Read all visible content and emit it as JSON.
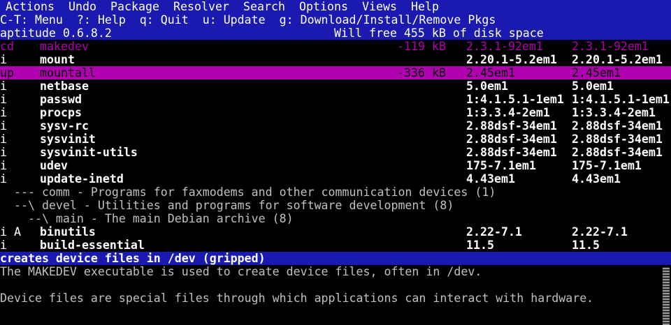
{
  "menubar": {
    "items": [
      "Actions",
      "Undo",
      "Package",
      "Resolver",
      "Search",
      "Options",
      "Views",
      "Help"
    ]
  },
  "hints": "C-T: Menu  ?: Help  q: Quit  u: Update  g: Download/Install/Remove Pkgs",
  "header": {
    "app": "aptitude 0.6.8.2",
    "status": "Will free 455 kB of disk space"
  },
  "packages": [
    {
      "flags": "cd",
      "name": "makedev",
      "size": "-119 kB",
      "v1": "2.3.1-92em1",
      "v2": "2.3.1-92em1",
      "style": "magenta"
    },
    {
      "flags": "i",
      "name": "mount",
      "size": "",
      "v1": "2.20.1-5.2em1",
      "v2": "2.20.1-5.2em1",
      "style": "normal"
    },
    {
      "flags": "up",
      "name": "mountall",
      "size": "-336 kB",
      "v1": "2.45em1",
      "v2": "2.45em1",
      "style": "selected"
    },
    {
      "flags": "i",
      "name": "netbase",
      "size": "",
      "v1": "5.0em1",
      "v2": "5.0em1",
      "style": "normal"
    },
    {
      "flags": "i",
      "name": "passwd",
      "size": "",
      "v1": "1:4.1.5.1-1em1",
      "v2": "1:4.1.5.1-1em1",
      "style": "normal"
    },
    {
      "flags": "i",
      "name": "procps",
      "size": "",
      "v1": "1:3.3.4-2em1",
      "v2": "1:3.3.4-2em1",
      "style": "normal"
    },
    {
      "flags": "i",
      "name": "sysv-rc",
      "size": "",
      "v1": "2.88dsf-34em1",
      "v2": "2.88dsf-34em1",
      "style": "normal"
    },
    {
      "flags": "i",
      "name": "sysvinit",
      "size": "",
      "v1": "2.88dsf-34em1",
      "v2": "2.88dsf-34em1",
      "style": "normal"
    },
    {
      "flags": "i",
      "name": "sysvinit-utils",
      "size": "",
      "v1": "2.88dsf-34em1",
      "v2": "2.88dsf-34em1",
      "style": "normal"
    },
    {
      "flags": "i",
      "name": "udev",
      "size": "",
      "v1": "175-7.1em1",
      "v2": "175-7.1em1",
      "style": "normal"
    },
    {
      "flags": "i",
      "name": "update-inetd",
      "size": "",
      "v1": "4.43em1",
      "v2": "4.43em1",
      "style": "normal"
    }
  ],
  "groups": [
    "  --- comm - Programs for faxmodems and other communication devices (1)",
    "  --\\ devel - Utilities and programs for software development (8)",
    "    --\\ main - The main Debian archive (8)"
  ],
  "packages2": [
    {
      "flags": "i A",
      "name": "binutils",
      "size": "",
      "v1": "2.22-7.1",
      "v2": "2.22-7.1",
      "style": "normal"
    },
    {
      "flags": "i",
      "name": "build-essential",
      "size": "",
      "v1": "11.5",
      "v2": "11.5",
      "style": "normal"
    }
  ],
  "description": {
    "summary": "creates device files in /dev (gripped)",
    "lines": [
      "The MAKEDEV executable is used to create device files, often in /dev.",
      "",
      "Device files are special files through which applications can interact with hardware."
    ]
  }
}
